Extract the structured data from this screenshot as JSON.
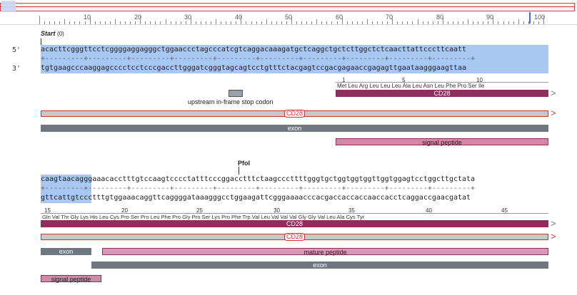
{
  "ruler": {
    "labels": [
      "10",
      "20",
      "30",
      "40",
      "50",
      "60",
      "70",
      "80",
      "90",
      "100"
    ]
  },
  "row1": {
    "start_label": "Start",
    "start_pos": "(0)",
    "strand_top_label": "5'",
    "strand_bottom_label": "3'",
    "top_seq": "acacttcgggttcctcggggaggagggctggaaccctagcccatcgtcaggacaaagatgctcaggctgctcttggctctcaacttattcccttcaatt",
    "bottom_seq": "tgtgaagcccaaggagcccctcctcccgaccttgggatcgggtagcagtcctgtttctacgagtccgacgagaaccgagagttgaataagggaagttaa",
    "ticks_line": "+---------+---------+---------+---------+---------+---------+---------+---------+---------+---------+",
    "aa_numbers": [
      "1",
      "5",
      "10"
    ],
    "aa_seq": "Met Leu Arg Leu Leu Leu Ala Leu Asn Leu Phe Pro Ser Ile",
    "cd28_label": "CD28",
    "cds_label": "CD28",
    "stop_codon_label": "upstream in-frame stop codon",
    "exon_label": "exon",
    "signal_label": "signal peptide"
  },
  "row2": {
    "enzyme_label": "PfoI",
    "top_seq": "caagtaacagggaaacacctttgtccaagtcccctatttcccggacctttctaagcccttttgggtgctggtggtggttggtggagtcctggcttgctata",
    "bottom_seq": "gttcattgtccctttgtggaaacaggttcaggggataaagggcctggaagattcgggaaaacccacgaccaccaccaaccacctcaggaccgaacgatat",
    "ticks_line": "+---------+---------+---------+---------+---------+---------+---------+---------+---------+---------+",
    "aa_numbers": [
      "15",
      "20",
      "25",
      "30",
      "35",
      "40",
      "45"
    ],
    "aa_seq": "Gln Val Thr Gly Lys His Leu Cys Pro Ser Pro Leu Phe Pro Gly Pro Ser Lys Pro Phe Trp Val Leu Val Val Val Gly Gly Val Leu Ala Cys Tyr",
    "cd28_label": "CD28",
    "cds_label": "CD28",
    "exon_label": "exon",
    "mature_label": "mature peptide",
    "exon2_label": "exon",
    "signal_label": "signal peptide"
  }
}
